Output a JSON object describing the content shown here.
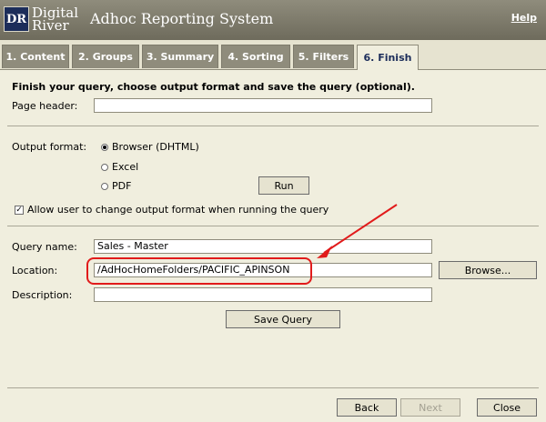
{
  "header": {
    "logo_mark": "DR",
    "logo_line1": "Digital",
    "logo_line2": "River",
    "app_title": "Adhoc Reporting System",
    "help_label": "Help"
  },
  "tabs": [
    {
      "label": "1. Content",
      "active": false
    },
    {
      "label": "2. Groups",
      "active": false
    },
    {
      "label": "3. Summary",
      "active": false
    },
    {
      "label": "4. Sorting",
      "active": false
    },
    {
      "label": "5. Filters",
      "active": false
    },
    {
      "label": "6. Finish",
      "active": true
    }
  ],
  "form": {
    "heading": "Finish your query, choose output format and save the query (optional).",
    "page_header_label": "Page header:",
    "page_header_value": "",
    "output_format_label": "Output format:",
    "output_options": [
      {
        "label": "Browser (DHTML)",
        "selected": true
      },
      {
        "label": "Excel",
        "selected": false
      },
      {
        "label": "PDF",
        "selected": false
      }
    ],
    "run_label": "Run",
    "allow_change_label": "Allow user to change output format when running the query",
    "allow_change_checked": true,
    "allow_change_mark": "✓",
    "query_name_label": "Query name:",
    "query_name_value": "Sales - Master",
    "location_label": "Location:",
    "location_value": "/AdHocHomeFolders/PACIFIC_APINSON",
    "browse_label": "Browse...",
    "description_label": "Description:",
    "description_value": "",
    "save_query_label": "Save Query"
  },
  "footer": {
    "back_label": "Back",
    "next_label": "Next",
    "close_label": "Close"
  },
  "colors": {
    "header_bg": "#7e7b6b",
    "page_bg": "#f0eede",
    "active_tab_text": "#1c2d5a",
    "annotation_red": "#e11b1b"
  }
}
